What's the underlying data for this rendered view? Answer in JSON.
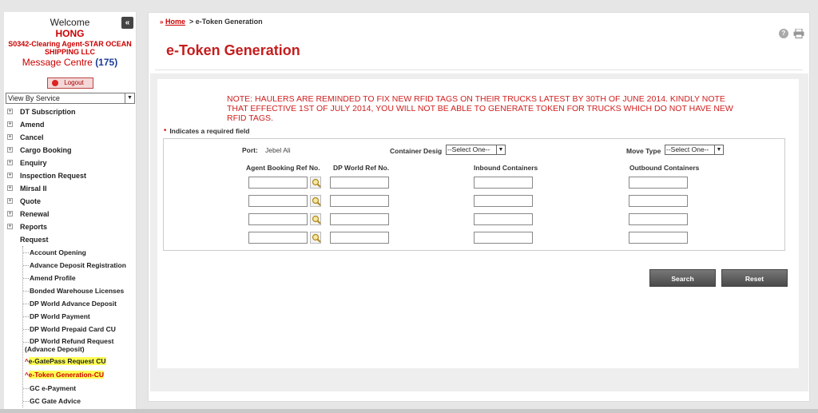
{
  "sidebar": {
    "collapse_icon": "«",
    "welcome": "Welcome",
    "user_name": "HONG",
    "agent": "S0342-Clearing Agent-STAR OCEAN SHIPPING LLC",
    "message_centre": "Message Centre",
    "message_count": "(175)",
    "logout_label": "Logout",
    "view_select": "View By Service",
    "menu": [
      "DT Subscription",
      "Amend",
      "Cancel",
      "Cargo Booking",
      "Enquiry",
      "Inspection Request",
      "Mirsal II",
      "Quote",
      "Renewal",
      "Reports"
    ],
    "request_label": "Request",
    "sub_items": [
      "Account Opening",
      "Advance Deposit Registration",
      "Amend Profile",
      "Bonded Warehouse Licenses",
      "DP World Advance Deposit",
      "DP World Payment",
      "DP World Prepaid Card CU"
    ],
    "refund_line1": "DP World Refund Request",
    "refund_line2": "(Advance Deposit)",
    "gatepass": "e-GatePass Request CU",
    "etoken": "e-Token Generation-CU",
    "gc_payment": "GC e-Payment",
    "gc_gate": "GC Gate Advice"
  },
  "breadcrumb": {
    "prefix": "»",
    "home": "Home",
    "separator": ">",
    "current": "e-Token Generation"
  },
  "page_title": "e-Token Generation",
  "notice": "NOTE: HAULERS ARE REMINDED TO FIX NEW RFID TAGS ON THEIR TRUCKS LATEST BY 30TH OF JUNE 2014. KINDLY NOTE THAT EFFECTIVE 1ST OF JULY 2014, YOU WILL NOT BE ABLE TO GENERATE TOKEN FOR TRUCKS WHICH DO NOT HAVE NEW RFID TAGS.",
  "required_note": {
    "star": "*",
    "text": "Indicates a required field"
  },
  "form": {
    "port_label": "Port:",
    "port_value": "Jebel Ali",
    "container_desig_label": "Container Desig",
    "container_desig_value": "--Select One--",
    "move_type_label": "Move Type",
    "move_type_value": "--Select One--",
    "col_agent_booking": "Agent Booking Ref No.",
    "col_dp_world": "DP World Ref No.",
    "col_inbound": "Inbound Containers",
    "col_outbound": "Outbound Containers"
  },
  "buttons": {
    "search": "Search",
    "reset": "Reset"
  },
  "icons": {
    "help": "?",
    "search_icon": "magnifier-icon",
    "print": "printer-icon"
  }
}
